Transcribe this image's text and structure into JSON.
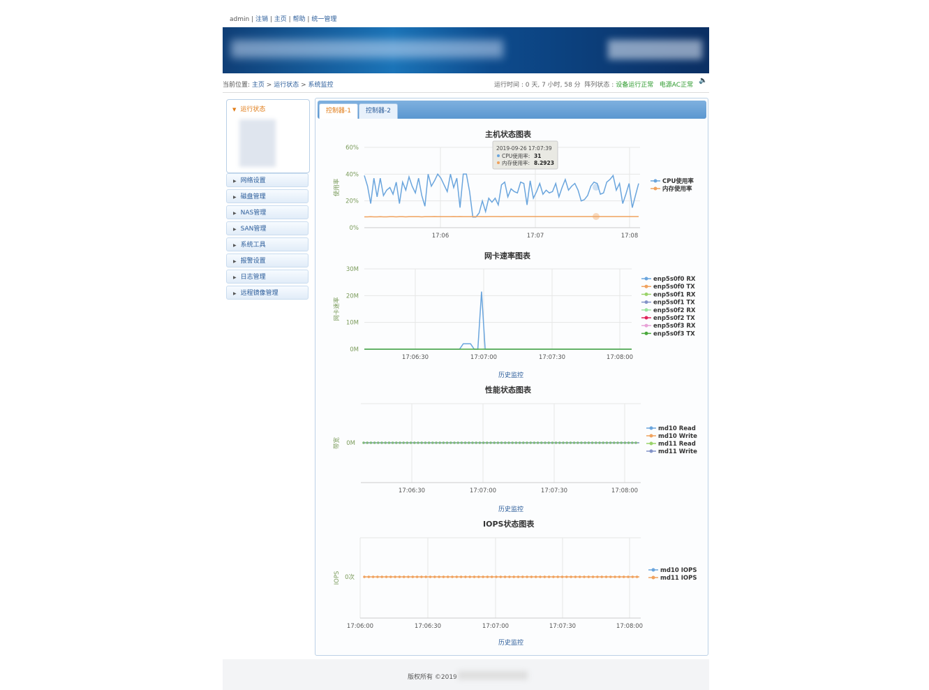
{
  "top_links": {
    "user": "admin",
    "sep": " | ",
    "logout": "注销",
    "home": "主页",
    "help": "帮助",
    "unified": "统一管理"
  },
  "breadcrumb": {
    "prefix": "当前位置: ",
    "home": "主页",
    "gt": " > ",
    "status": "运行状态",
    "gt2": " > ",
    "monitor": "系统监控"
  },
  "status_bar": {
    "uptime": "运行时间 : 0 天, 7 小时, 58 分",
    "array_label": "阵列状态 : ",
    "array_value": "设备运行正常",
    "power": "电源AC正常"
  },
  "sidebar": {
    "active": "运行状态",
    "items": [
      {
        "label": "网络设置"
      },
      {
        "label": "磁盘管理"
      },
      {
        "label": "NAS管理"
      },
      {
        "label": "SAN管理"
      },
      {
        "label": "系统工具"
      },
      {
        "label": "报警设置"
      },
      {
        "label": "日志管理"
      },
      {
        "label": "远程镜像管理"
      }
    ]
  },
  "tabs": [
    {
      "label": "控制器-1",
      "active": true
    },
    {
      "label": "控制器-2",
      "active": false
    }
  ],
  "history_link": "历史监控",
  "footer": {
    "copyright": "版权所有 ©2019 "
  },
  "colors": {
    "blue": "#6aa5dd",
    "orange": "#f0a25e",
    "green": "#9ad36a",
    "purple": "#8393c8",
    "red": "#e0245a",
    "pink": "#e8a3d8",
    "dgreen": "#4aa83c",
    "lgreen": "#9be6a0",
    "grid": "#e6e6e6"
  },
  "chart_data": [
    {
      "type": "line",
      "title": "主机状态图表",
      "ylabel": "使用率",
      "yticks": [
        "0%",
        "20%",
        "40%",
        "60%"
      ],
      "ylim": [
        0,
        60
      ],
      "xticks": [
        "17:06",
        "17:07",
        "17:08"
      ],
      "tooltip": {
        "time": "2019-09-26 17:07:39",
        "cpu_label": "CPU使用率: ",
        "cpu_value": "31",
        "mem_label": "内存使用率: ",
        "mem_value": "8.2923"
      },
      "series": [
        {
          "name": "CPU使用率",
          "values": [
            39,
            31,
            18,
            37,
            23,
            37,
            24,
            28,
            30,
            25,
            34,
            18,
            34,
            28,
            38,
            31,
            26,
            37,
            24,
            16,
            40,
            31,
            35,
            40,
            37,
            32,
            27,
            40,
            30,
            37,
            15,
            40,
            40,
            27,
            8,
            8,
            11,
            20,
            12,
            22,
            19,
            22,
            17,
            32,
            34,
            23,
            29,
            27,
            26,
            34,
            33,
            17,
            35,
            22,
            27,
            33,
            25,
            28,
            26,
            27,
            33,
            23,
            30,
            36,
            28,
            31,
            33,
            28,
            20,
            21,
            24,
            31,
            34,
            33,
            25,
            26,
            34,
            36,
            39,
            28,
            33,
            18,
            25,
            33,
            15,
            24,
            33
          ]
        },
        {
          "name": "内存使用率",
          "values": [
            8.1,
            8.1,
            8.2,
            8.1,
            8.1,
            8.2,
            8.1,
            8.1,
            8.2,
            8.2,
            8.1,
            8.2,
            8.2,
            8.1,
            8.2,
            8.2,
            8.2,
            8.2,
            8.1,
            8.2,
            8.2,
            8.2,
            8.3,
            8.2,
            8.2,
            8.2,
            8.2,
            8.2,
            8.3,
            8.2,
            8.3,
            8.2,
            8.2,
            8.2,
            8.3,
            8.3,
            8.3,
            8.2,
            8.2,
            8.3,
            8.3,
            8.3,
            8.3,
            8.2,
            8.3,
            8.3,
            8.3,
            8.3,
            8.3,
            8.3,
            8.3,
            8.3,
            8.3,
            8.3,
            8.3,
            8.3,
            8.3,
            8.3,
            8.3,
            8.3,
            8.3,
            8.3,
            8.3,
            8.3,
            8.3,
            8.3,
            8.3,
            8.3,
            8.3,
            8.3,
            8.3,
            8.3,
            8.3,
            8.3,
            8.3,
            8.3,
            8.3,
            8.3,
            8.3,
            8.3,
            8.3,
            8.3,
            8.3,
            8.3,
            8.3,
            8.3,
            8.3
          ]
        }
      ]
    },
    {
      "type": "line",
      "title": "网卡速率图表",
      "ylabel": "网卡速率",
      "yticks": [
        "0M",
        "10M",
        "20M",
        "30M"
      ],
      "ylim": [
        0,
        30
      ],
      "xticks": [
        "17:06:30",
        "17:07:00",
        "17:07:30",
        "17:08:00"
      ],
      "series": [
        {
          "name": "enp5s0f0 RX",
          "values": [
            0,
            0,
            0,
            0,
            0,
            0,
            0,
            0,
            0,
            0,
            0,
            0,
            0,
            0,
            0,
            0,
            0,
            0,
            0,
            0,
            0,
            0,
            0,
            0,
            0,
            0,
            0,
            2,
            2,
            2,
            0,
            0,
            21.5,
            0,
            0,
            0,
            0,
            0,
            0,
            0,
            0,
            0,
            0,
            0,
            0,
            0,
            0,
            0,
            0,
            0,
            0,
            0,
            0,
            0,
            0,
            0,
            0,
            0,
            0,
            0,
            0,
            0,
            0,
            0,
            0,
            0,
            0,
            0,
            0,
            0,
            0,
            0,
            0,
            0
          ]
        },
        {
          "name": "enp5s0f0 TX",
          "values": []
        },
        {
          "name": "enp5s0f1 RX",
          "values": []
        },
        {
          "name": "enp5s0f1 TX",
          "values": []
        },
        {
          "name": "enp5s0f2 RX",
          "values": []
        },
        {
          "name": "enp5s0f2 TX",
          "values": []
        },
        {
          "name": "enp5s0f3 RX",
          "values": []
        },
        {
          "name": "enp5s0f3 TX",
          "values": [
            0,
            0,
            0
          ]
        }
      ]
    },
    {
      "type": "line",
      "title": "性能状态图表",
      "ylabel": "带宽",
      "yticks": [
        "0M"
      ],
      "xticks": [
        "17:06:30",
        "17:07:00",
        "17:07:30",
        "17:08:00"
      ],
      "series": [
        {
          "name": "md10 Read",
          "values": [
            0
          ]
        },
        {
          "name": "md10 Write",
          "values": [
            0
          ]
        },
        {
          "name": "md11 Read",
          "values": [
            0
          ]
        },
        {
          "name": "md11 Write",
          "values": [
            0
          ]
        }
      ]
    },
    {
      "type": "line",
      "title": "IOPS状态图表",
      "ylabel": "IOPS",
      "yticks": [
        "0次"
      ],
      "xticks": [
        "17:06:00",
        "17:06:30",
        "17:07:00",
        "17:07:30",
        "17:08:00"
      ],
      "series": [
        {
          "name": "md10 IOPS",
          "values": [
            0
          ]
        },
        {
          "name": "md11 IOPS",
          "values": [
            0
          ]
        }
      ]
    }
  ]
}
